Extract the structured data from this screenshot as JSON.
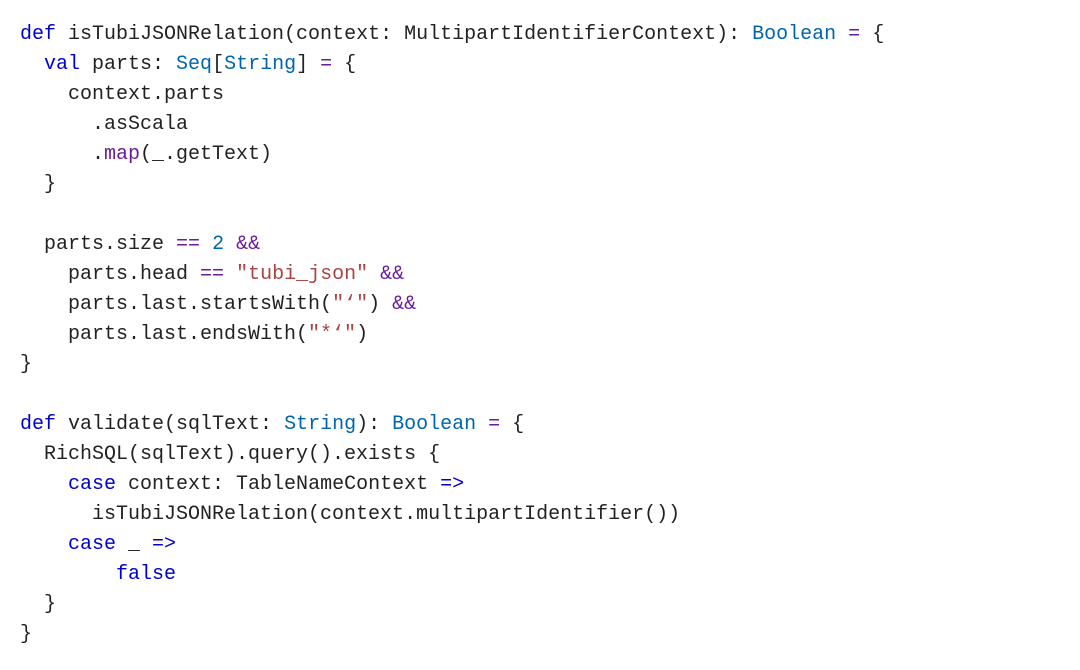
{
  "code": {
    "lines": [
      [
        {
          "cls": "kw",
          "t": "def"
        },
        {
          "cls": "txt",
          "t": " isTubiJSONRelation(context: MultipartIdentifierContext): "
        },
        {
          "cls": "type",
          "t": "Boolean"
        },
        {
          "cls": "txt",
          "t": " "
        },
        {
          "cls": "op",
          "t": "="
        },
        {
          "cls": "txt",
          "t": " {"
        }
      ],
      [
        {
          "cls": "txt",
          "t": "  "
        },
        {
          "cls": "kw",
          "t": "val"
        },
        {
          "cls": "txt",
          "t": " parts: "
        },
        {
          "cls": "type",
          "t": "Seq"
        },
        {
          "cls": "txt",
          "t": "["
        },
        {
          "cls": "type",
          "t": "String"
        },
        {
          "cls": "txt",
          "t": "] "
        },
        {
          "cls": "op",
          "t": "="
        },
        {
          "cls": "txt",
          "t": " {"
        }
      ],
      [
        {
          "cls": "txt",
          "t": "    context.parts"
        }
      ],
      [
        {
          "cls": "txt",
          "t": "      .asScala"
        }
      ],
      [
        {
          "cls": "txt",
          "t": "      ."
        },
        {
          "cls": "method",
          "t": "map"
        },
        {
          "cls": "txt",
          "t": "(_.getText)"
        }
      ],
      [
        {
          "cls": "txt",
          "t": "  }"
        }
      ],
      [
        {
          "cls": "txt",
          "t": ""
        }
      ],
      [
        {
          "cls": "txt",
          "t": "  parts.size "
        },
        {
          "cls": "op",
          "t": "=="
        },
        {
          "cls": "txt",
          "t": " "
        },
        {
          "cls": "type",
          "t": "2"
        },
        {
          "cls": "txt",
          "t": " "
        },
        {
          "cls": "op",
          "t": "&&"
        }
      ],
      [
        {
          "cls": "txt",
          "t": "    parts.head "
        },
        {
          "cls": "op",
          "t": "=="
        },
        {
          "cls": "txt",
          "t": " "
        },
        {
          "cls": "str",
          "t": "\"tubi_json\""
        },
        {
          "cls": "txt",
          "t": " "
        },
        {
          "cls": "op",
          "t": "&&"
        }
      ],
      [
        {
          "cls": "txt",
          "t": "    parts.last.startsWith("
        },
        {
          "cls": "str",
          "t": "\"‘\""
        },
        {
          "cls": "txt",
          "t": ") "
        },
        {
          "cls": "op",
          "t": "&&"
        }
      ],
      [
        {
          "cls": "txt",
          "t": "    parts.last.endsWith("
        },
        {
          "cls": "str",
          "t": "\"*‘\""
        },
        {
          "cls": "txt",
          "t": ")"
        }
      ],
      [
        {
          "cls": "txt",
          "t": "}"
        }
      ],
      [
        {
          "cls": "txt",
          "t": ""
        }
      ],
      [
        {
          "cls": "kw",
          "t": "def"
        },
        {
          "cls": "txt",
          "t": " validate(sqlText: "
        },
        {
          "cls": "type",
          "t": "String"
        },
        {
          "cls": "txt",
          "t": "): "
        },
        {
          "cls": "type",
          "t": "Boolean"
        },
        {
          "cls": "txt",
          "t": " "
        },
        {
          "cls": "op",
          "t": "="
        },
        {
          "cls": "txt",
          "t": " {"
        }
      ],
      [
        {
          "cls": "txt",
          "t": "  RichSQL(sqlText).query().exists {"
        }
      ],
      [
        {
          "cls": "txt",
          "t": "    "
        },
        {
          "cls": "kw",
          "t": "case"
        },
        {
          "cls": "txt",
          "t": " context: TableNameContext "
        },
        {
          "cls": "arrow",
          "t": "=>"
        }
      ],
      [
        {
          "cls": "txt",
          "t": "      isTubiJSONRelation(context.multipartIdentifier())"
        }
      ],
      [
        {
          "cls": "txt",
          "t": "    "
        },
        {
          "cls": "kw",
          "t": "case"
        },
        {
          "cls": "txt",
          "t": " _ "
        },
        {
          "cls": "arrow",
          "t": "=>"
        }
      ],
      [
        {
          "cls": "txt",
          "t": "        "
        },
        {
          "cls": "kw",
          "t": "false"
        }
      ],
      [
        {
          "cls": "txt",
          "t": "  }"
        }
      ],
      [
        {
          "cls": "txt",
          "t": "}"
        }
      ]
    ]
  }
}
